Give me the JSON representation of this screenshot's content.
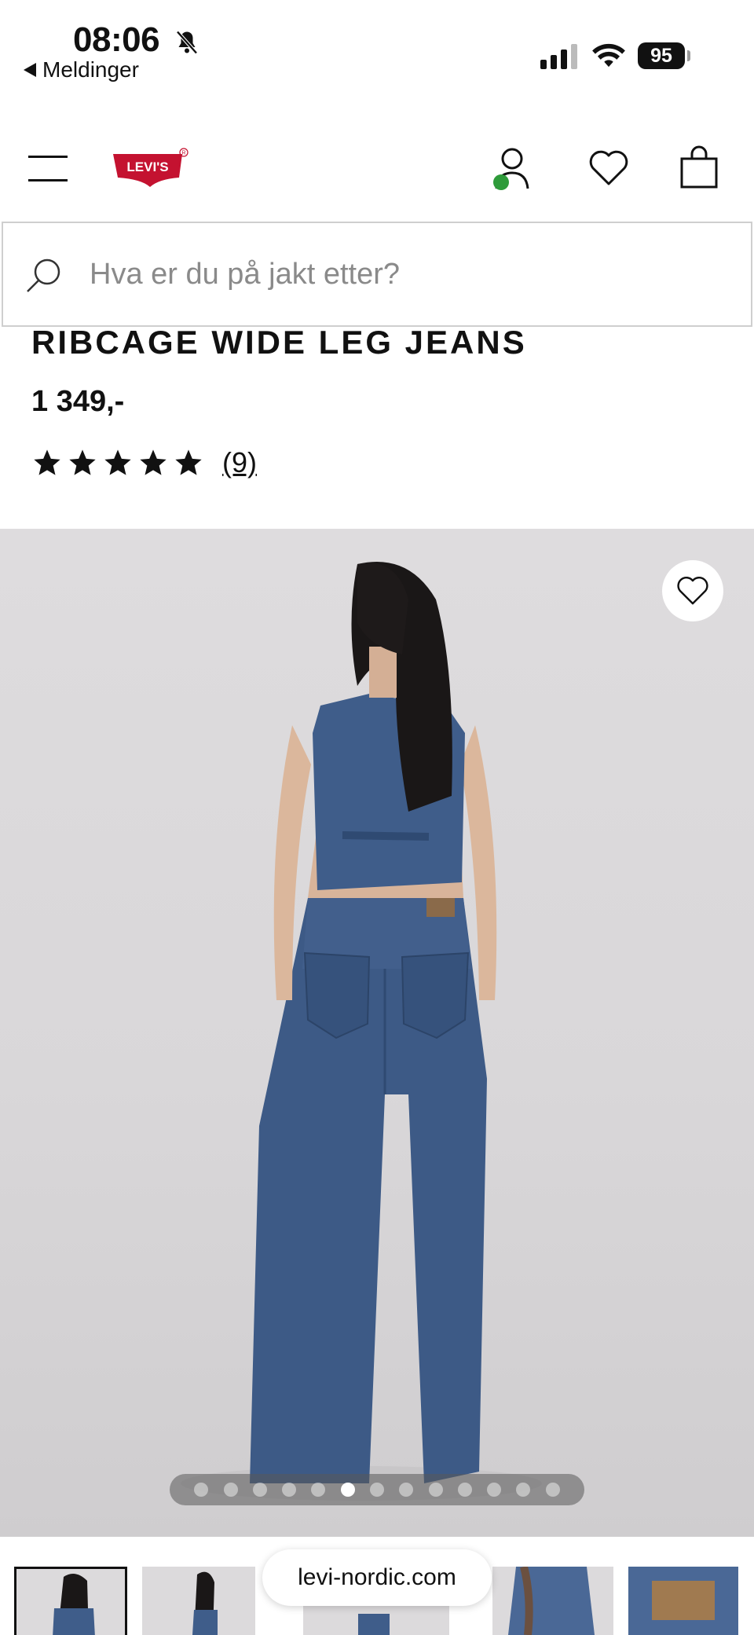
{
  "status_bar": {
    "time": "08:06",
    "back_label": "Meldinger",
    "battery": "95"
  },
  "header": {
    "logo_text": "LEVI'S",
    "brand_color": "#c41230",
    "account_status_color": "#2e9b3a"
  },
  "search": {
    "placeholder": "Hva er du på jakt etter?"
  },
  "product": {
    "title": "RIBCAGE WIDE LEG JEANS",
    "price": "1 349,-",
    "rating_stars": 5,
    "review_count": "(9)"
  },
  "gallery": {
    "image_count": 13,
    "active_index": 5
  },
  "browser": {
    "url": "levi-nordic.com"
  },
  "icons": [
    "bell-muted-icon",
    "signal-icon",
    "wifi-icon",
    "battery-icon",
    "menu-icon",
    "account-icon",
    "heart-icon",
    "shopping-bag-icon",
    "search-icon",
    "star-icon"
  ]
}
